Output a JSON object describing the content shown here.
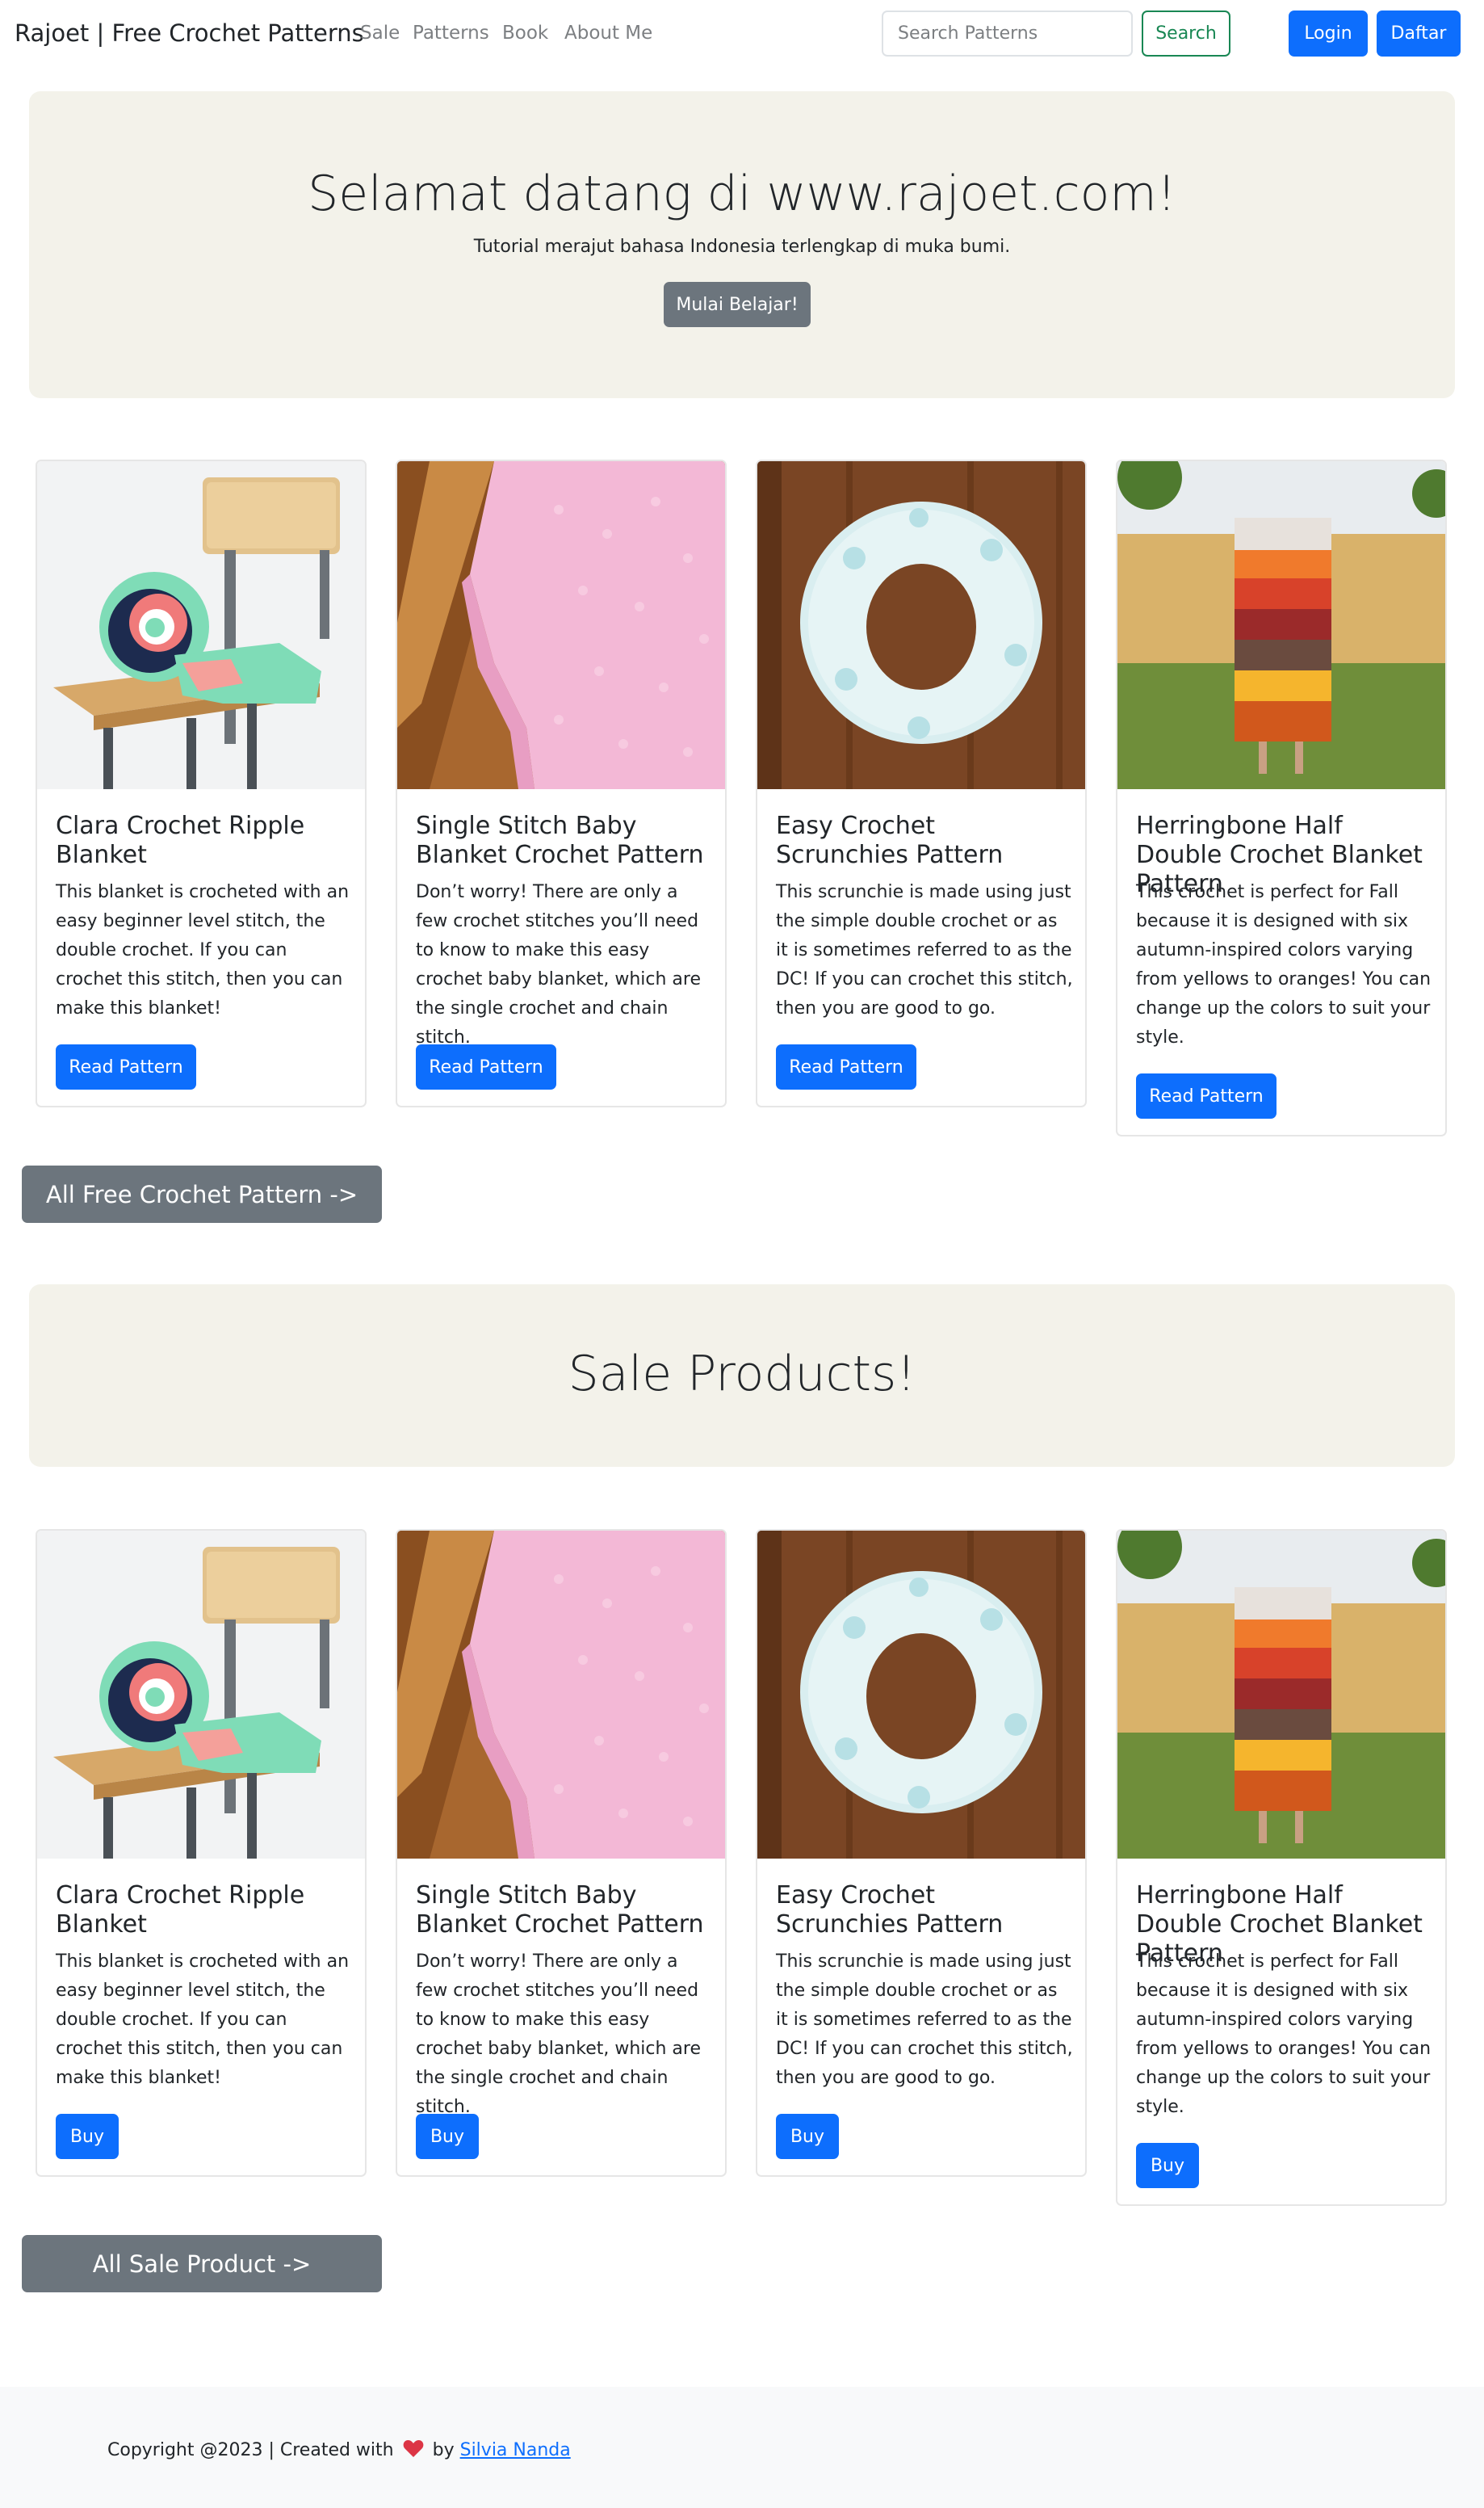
{
  "nav": {
    "brand": "Rajoet | Free Crochet Patterns",
    "links": [
      "Sale",
      "Patterns",
      "Book",
      "About Me"
    ],
    "search_placeholder": "Search Patterns",
    "search_label": "Search",
    "login_label": "Login",
    "daftar_label": "Daftar"
  },
  "hero": {
    "title": "Selamat datang di www.rajoet.com!",
    "subtitle": "Tutorial merajut bahasa Indonesia terlengkap di muka bumi.",
    "button": "Mulai Belajar!"
  },
  "patterns": {
    "cards": [
      {
        "title": "Clara Crochet Ripple Blanket",
        "text": "This blanket is crocheted with an easy beginner level stitch, the double crochet. If you can crochet this stitch, then you can make this blanket!",
        "button": "Read Pattern",
        "image": "ripple-blanket-on-chair"
      },
      {
        "title": "Single Stitch Baby Blanket Crochet Pattern",
        "text": "Don’t worry! There are only a few crochet stitches you’ll need to know to make this easy crochet baby blanket, which are the single crochet and chain stitch.",
        "button": "Read Pattern",
        "image": "pink-baby-blanket"
      },
      {
        "title": "Easy Crochet Scrunchies Pattern",
        "text": "This scrunchie is made using just the simple double crochet or as it is sometimes referred to as the DC! If you can crochet this stitch, then you are good to go.",
        "button": "Read Pattern",
        "image": "fluffy-scrunchie"
      },
      {
        "title": "Herringbone Half Double Crochet Blanket Pattern",
        "text": "This crochet is perfect for Fall because it is designed with six autumn-inspired colors varying from yellows to oranges! You can change up the colors to suit your style.",
        "button": "Read Pattern",
        "image": "autumn-striped-blanket"
      }
    ],
    "all_button": "All Free Crochet Pattern ->"
  },
  "sale": {
    "title": "Sale Products!",
    "cards": [
      {
        "title": "Clara Crochet Ripple Blanket",
        "text": "This blanket is crocheted with an easy beginner level stitch, the double crochet. If you can crochet this stitch, then you can make this blanket!",
        "button": "Buy",
        "image": "ripple-blanket-on-chair"
      },
      {
        "title": "Single Stitch Baby Blanket Crochet Pattern",
        "text": "Don’t worry! There are only a few crochet stitches you’ll need to know to make this easy crochet baby blanket, which are the single crochet and chain stitch.",
        "button": "Buy",
        "image": "pink-baby-blanket"
      },
      {
        "title": "Easy Crochet Scrunchies Pattern",
        "text": "This scrunchie is made using just the simple double crochet or as it is sometimes referred to as the DC! If you can crochet this stitch, then you are good to go.",
        "button": "Buy",
        "image": "fluffy-scrunchie"
      },
      {
        "title": "Herringbone Half Double Crochet Blanket Pattern",
        "text": "This crochet is perfect for Fall because it is designed with six autumn-inspired colors varying from yellows to oranges! You can change up the colors to suit your style.",
        "button": "Buy",
        "image": "autumn-striped-blanket"
      }
    ],
    "all_button": "All Sale Product ->"
  },
  "footer": {
    "prefix": "Copyright @2023 | Created with",
    "by": "by",
    "author": "Silvia Nanda",
    "heart_icon": "heart-icon",
    "heart_color": "#dc3545"
  },
  "colors": {
    "primary": "#0d6efd",
    "secondary": "#6c757d",
    "success": "#198754",
    "jumbotron_bg": "#f3f2ea"
  }
}
